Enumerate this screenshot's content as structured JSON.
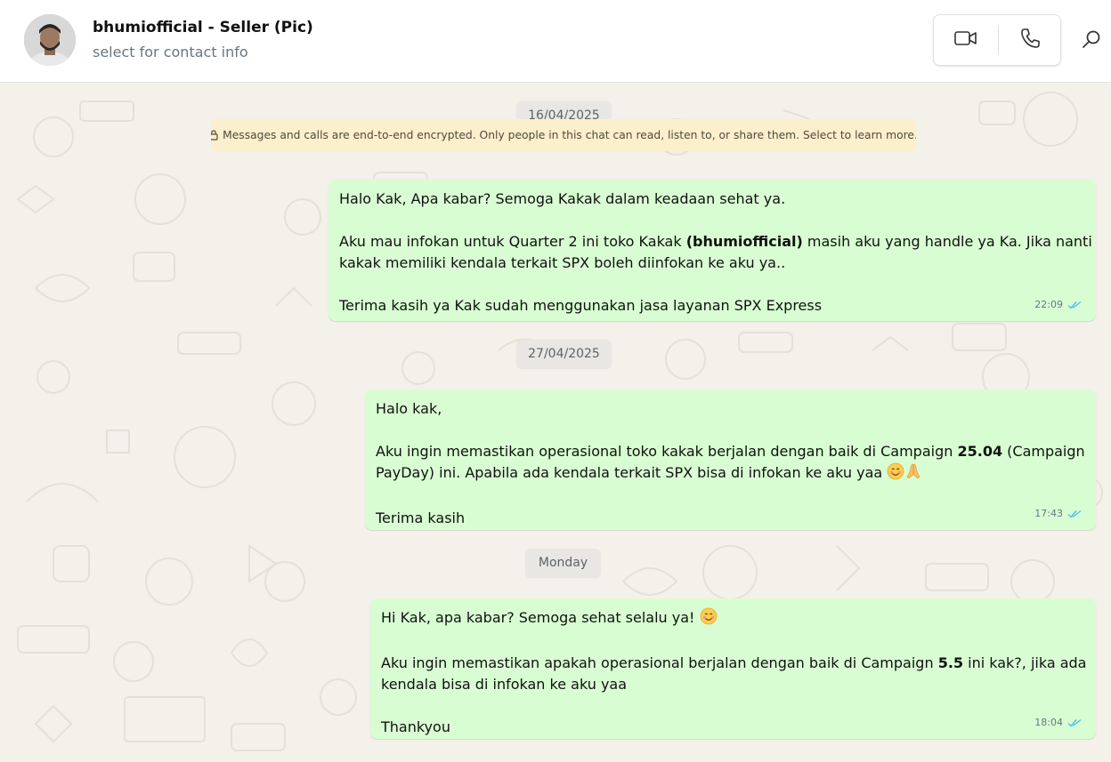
{
  "header": {
    "contact_name": "bhumiofficial - Seller (Pic)",
    "contact_subtitle": "select for contact info",
    "icons": [
      "video-call-icon",
      "voice-call-icon",
      "search-icon"
    ]
  },
  "notice": {
    "text": "Messages and calls are end-to-end encrypted. Only people in this chat can read, listen to, or share them. Select to learn more."
  },
  "dates": [
    "16/04/2025",
    "27/04/2025",
    "Monday"
  ],
  "messages": [
    {
      "time": "22:09",
      "lines": {
        "l1": "Halo Kak, Apa kabar? Semoga Kakak dalam keadaan sehat ya.",
        "l2a": "Aku mau infokan untuk Quarter 2 ini toko Kakak ",
        "l2b": "(bhumiofficial)",
        "l2c": " masih aku yang handle ya Ka. Jika nanti",
        "l3": "kakak memiliki kendala terkait SPX boleh diinfokan ke aku ya..",
        "l4": "Terima kasih ya Kak sudah menggunakan jasa layanan SPX Express"
      }
    },
    {
      "time": "17:43",
      "lines": {
        "l1": "Halo kak,",
        "l2a": "Aku ingin memastikan operasional toko kakak berjalan dengan baik di Campaign ",
        "l2b": "25.04",
        "l2c": " (Campaign",
        "l3": "PayDay) ini. Apabila ada kendala terkait SPX bisa di infokan ke aku yaa ",
        "l4": "Terima kasih"
      }
    },
    {
      "time": "18:04",
      "lines": {
        "l1": "Hi Kak, apa kabar? Semoga sehat selalu ya! ",
        "l2a": "Aku ingin memastikan apakah operasional berjalan dengan baik di Campaign ",
        "l2b": "5.5",
        "l2c": " ini kak?, jika ada",
        "l3": "kendala bisa di infokan ke aku yaa",
        "l4": "Thankyou"
      }
    }
  ],
  "colors": {
    "bubble_out": "#d9fdd3",
    "wallpaper": "#f4f0ea",
    "notice_bg": "#fcefcb",
    "read_tick": "#53bdeb"
  }
}
